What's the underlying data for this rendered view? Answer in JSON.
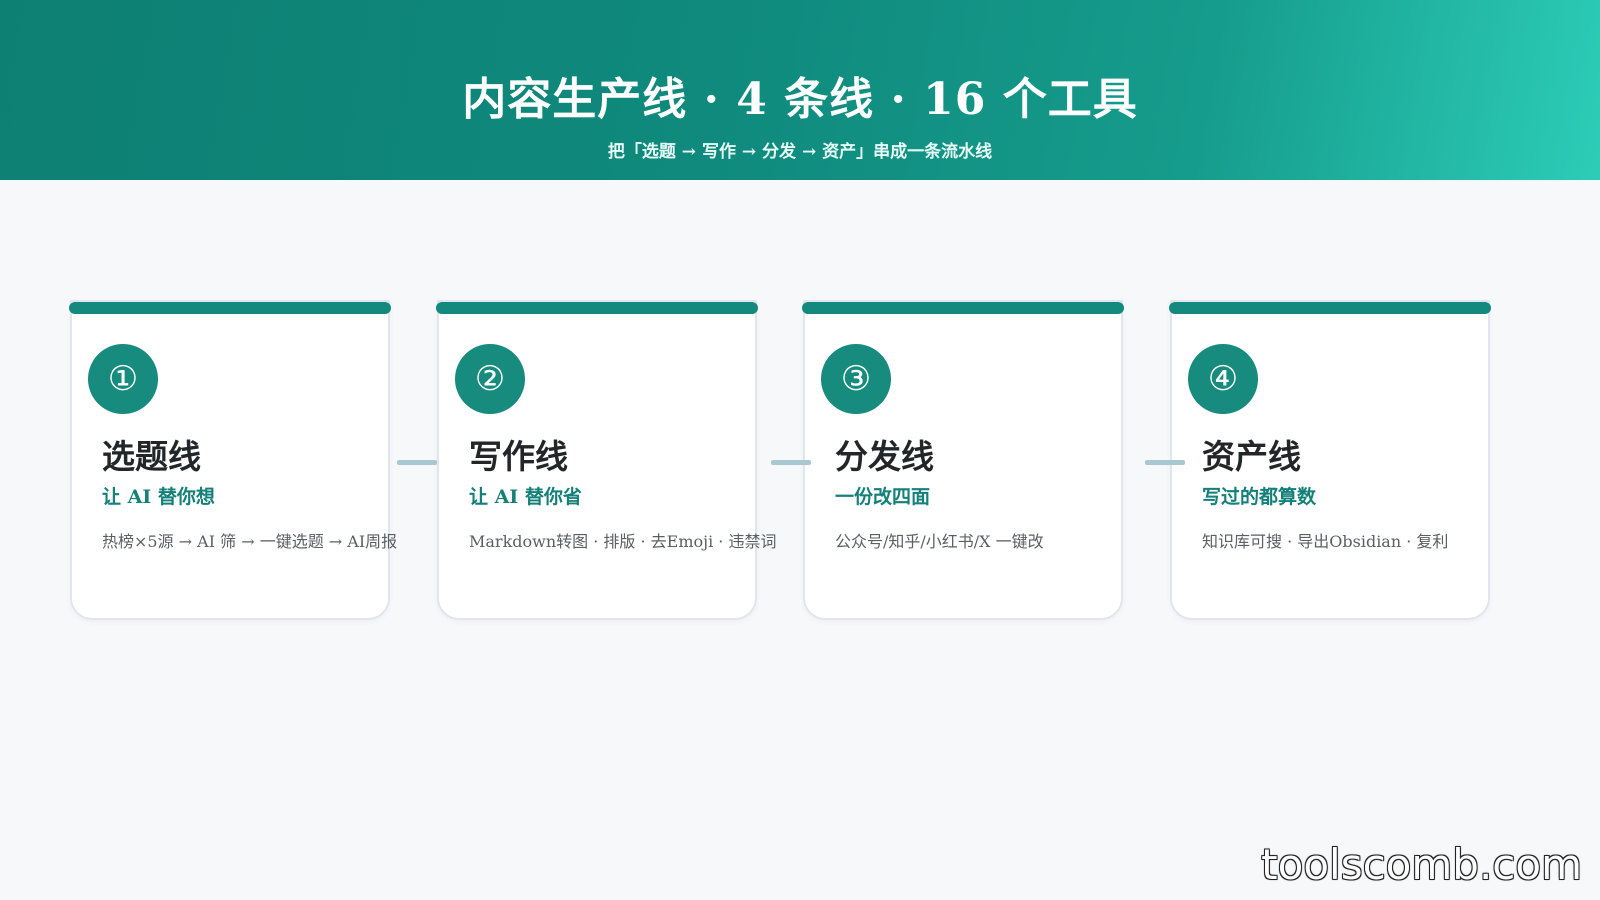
{
  "header": {
    "title": "内容生产线 · 4 条线 · 16 个工具",
    "subtitle": "把「选题 → 写作 → 分发 → 资产」串成一条流水线"
  },
  "cards": [
    {
      "num": "①",
      "name": "选题线",
      "tagline": "让 AI 替你想",
      "desc": "热榜×5源 → AI 筛 → 一键选题 → AI周报"
    },
    {
      "num": "②",
      "name": "写作线",
      "tagline": "让 AI 替你省",
      "desc": "Markdown转图 · 排版 · 去Emoji · 违禁词"
    },
    {
      "num": "③",
      "name": "分发线",
      "tagline": "一份改四面",
      "desc": "公众号/知乎/小红书/X 一键改"
    },
    {
      "num": "④",
      "name": "资产线",
      "tagline": "写过的都算数",
      "desc": "知识库可搜 · 导出Obsidian · 复利"
    }
  ],
  "watermark": "toolscomb.com",
  "colors": {
    "accent": "#14897d",
    "header_start": "#0e7f73",
    "header_end": "#2ccdb8",
    "connector": "#a9c7d0"
  }
}
